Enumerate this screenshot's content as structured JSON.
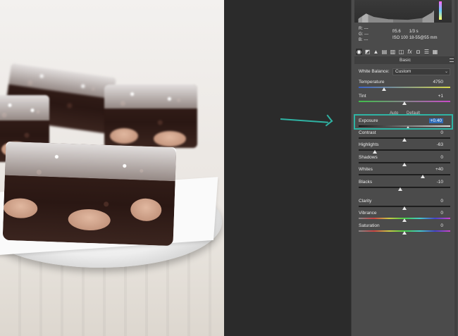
{
  "panel": {
    "info": {
      "r_label": "R:",
      "r_value": "---",
      "g_label": "G:",
      "g_value": "---",
      "b_label": "B:",
      "b_value": "---",
      "aperture": "f/5.6",
      "shutter": "1/3 s",
      "iso": "ISO 100",
      "lens": "18-55@55 mm"
    },
    "tabs": [
      {
        "icon": "aperture-icon",
        "glyph": "◉"
      },
      {
        "icon": "tone-curve-icon",
        "glyph": "◩"
      },
      {
        "icon": "detail-icon",
        "glyph": "▲"
      },
      {
        "icon": "hsl-icon",
        "glyph": "▤"
      },
      {
        "icon": "split-toning-icon",
        "glyph": "▥"
      },
      {
        "icon": "lens-icon",
        "glyph": "◫"
      },
      {
        "icon": "fx-icon",
        "glyph": "fx"
      },
      {
        "icon": "camera-icon",
        "glyph": "◘"
      },
      {
        "icon": "presets-icon",
        "glyph": "☰"
      },
      {
        "icon": "snapshots-icon",
        "glyph": "▦"
      }
    ],
    "section_title": "Basic",
    "white_balance": {
      "label": "White Balance:",
      "value": "Custom"
    },
    "auto_label": "Auto",
    "default_label": "Default",
    "sliders": {
      "temperature": {
        "label": "Temperature",
        "value": "4750",
        "position": 0.28
      },
      "tint": {
        "label": "Tint",
        "value": "+1",
        "position": 0.5
      },
      "exposure": {
        "label": "Exposure",
        "value": "+0.40",
        "position": 0.54
      },
      "contrast": {
        "label": "Contrast",
        "value": "0",
        "position": 0.5
      },
      "highlights": {
        "label": "Highlights",
        "value": "-63",
        "position": 0.18
      },
      "shadows": {
        "label": "Shadows",
        "value": "0",
        "position": 0.5
      },
      "whites": {
        "label": "Whites",
        "value": "+40",
        "position": 0.7
      },
      "blacks": {
        "label": "Blacks",
        "value": "-10",
        "position": 0.45
      },
      "clarity": {
        "label": "Clarity",
        "value": "0",
        "position": 0.5
      },
      "vibrance": {
        "label": "Vibrance",
        "value": "0",
        "position": 0.5
      },
      "saturation": {
        "label": "Saturation",
        "value": "0",
        "position": 0.5
      }
    }
  },
  "colors": {
    "highlight_box": "#2fb3a3",
    "arrow": "#2fb3a3",
    "value_highlight": "#2f6db8"
  }
}
